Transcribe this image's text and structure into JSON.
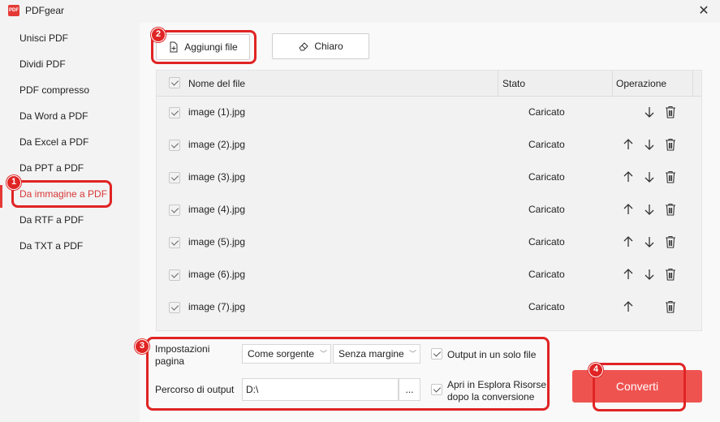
{
  "window": {
    "title": "PDFgear",
    "logo_text": "PDF"
  },
  "sidebar": {
    "items": [
      {
        "label": "Unisci PDF"
      },
      {
        "label": "Dividi PDF"
      },
      {
        "label": "PDF compresso"
      },
      {
        "label": "Da Word a PDF"
      },
      {
        "label": "Da Excel a PDF"
      },
      {
        "label": "Da PPT a PDF"
      },
      {
        "label": "Da immagine a PDF",
        "active": true
      },
      {
        "label": "Da RTF a PDF"
      },
      {
        "label": "Da TXT a PDF"
      }
    ]
  },
  "toolbar": {
    "add_label": "Aggiungi file",
    "clear_label": "Chiaro"
  },
  "table": {
    "headers": {
      "name": "Nome del file",
      "status": "Stato",
      "operation": "Operazione"
    },
    "rows": [
      {
        "name": "image (1).jpg",
        "status": "Caricato",
        "up": false,
        "down": true
      },
      {
        "name": "image (2).jpg",
        "status": "Caricato",
        "up": true,
        "down": true
      },
      {
        "name": "image (3).jpg",
        "status": "Caricato",
        "up": true,
        "down": true
      },
      {
        "name": "image (4).jpg",
        "status": "Caricato",
        "up": true,
        "down": true
      },
      {
        "name": "image (5).jpg",
        "status": "Caricato",
        "up": true,
        "down": true
      },
      {
        "name": "image (6).jpg",
        "status": "Caricato",
        "up": true,
        "down": true
      },
      {
        "name": "image (7).jpg",
        "status": "Caricato",
        "up": true,
        "down": false
      }
    ]
  },
  "settings": {
    "page_label_line1": "Impostazioni",
    "page_label_line2": "pagina",
    "page_size": "Come sorgente",
    "margin": "Senza margine",
    "single_output_label": "Output in un solo file",
    "output_path_label": "Percorso di output",
    "output_path_value": "D:\\",
    "browse_label": "...",
    "open_explorer_line1": "Apri in Esplora Risorse",
    "open_explorer_line2": "dopo la conversione"
  },
  "convert_label": "Converti",
  "annotations": [
    "1",
    "2",
    "3",
    "4"
  ],
  "colors": {
    "accent": "#e53935",
    "highlight": "#e02424",
    "convert": "#ef5350"
  }
}
